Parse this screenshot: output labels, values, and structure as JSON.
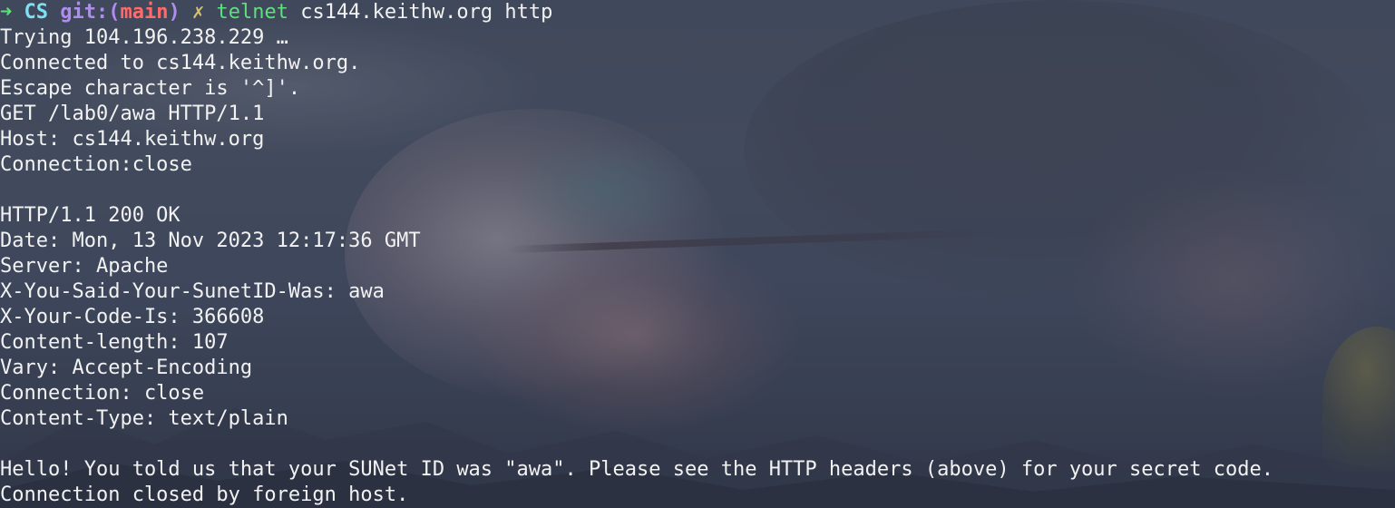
{
  "prompt": {
    "arrow": "➜",
    "dir": "CS",
    "git_label": "git:(",
    "branch": "main",
    "git_close": ")",
    "dirty_mark": "✗",
    "command": "telnet",
    "args": "cs144.keithw.org http"
  },
  "output_lines": [
    "Trying 104.196.238.229 …",
    "Connected to cs144.keithw.org.",
    "Escape character is '^]'.",
    "GET /lab0/awa HTTP/1.1",
    "Host: cs144.keithw.org",
    "Connection:close",
    "",
    "HTTP/1.1 200 OK",
    "Date: Mon, 13 Nov 2023 12:17:36 GMT",
    "Server: Apache",
    "X-You-Said-Your-SunetID-Was: awa",
    "X-Your-Code-Is: 366608",
    "Content-length: 107",
    "Vary: Accept-Encoding",
    "Connection: close",
    "Content-Type: text/plain",
    "",
    "Hello! You told us that your SUNet ID was \"awa\". Please see the HTTP headers (above) for your secret code.",
    "Connection closed by foreign host."
  ],
  "colors": {
    "prompt_arrow": "#5fe07f",
    "prompt_dir": "#7ee0f0",
    "prompt_git": "#b08cf0",
    "prompt_branch": "#ff6b6b",
    "command": "#5fe07f",
    "text": "#f2f2f2"
  }
}
